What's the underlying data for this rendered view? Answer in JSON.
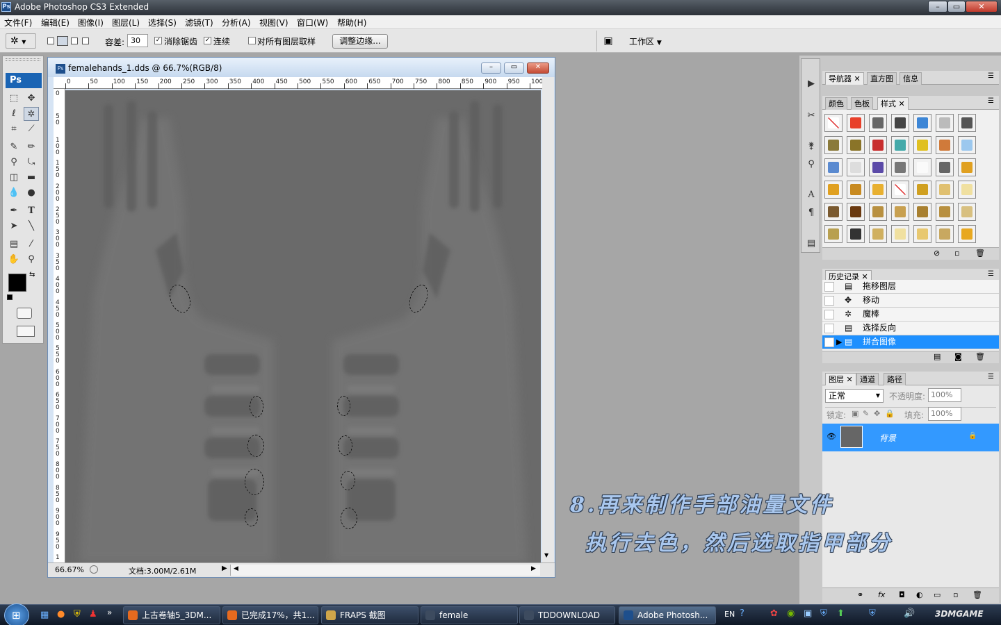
{
  "app": {
    "title": "Adobe Photoshop CS3 Extended",
    "badge": "Ps"
  },
  "menu": [
    "文件(F)",
    "编辑(E)",
    "图像(I)",
    "图层(L)",
    "选择(S)",
    "滤镜(T)",
    "分析(A)",
    "视图(V)",
    "窗口(W)",
    "帮助(H)"
  ],
  "options": {
    "tolerance_label": "容差:",
    "tolerance_value": "30",
    "antialias_label": "消除锯齿",
    "contiguous_label": "连续",
    "sample_all_label": "对所有图层取样",
    "refine_edge_label": "调整边缘...",
    "workspace_label": "工作区"
  },
  "document": {
    "title": "femalehands_1.dds @ 66.7%(RGB/8)",
    "zoom": "66.67%",
    "doc_info": "文档:3.00M/2.61M",
    "ruler_h": [
      "0",
      "50",
      "100",
      "150",
      "200",
      "250",
      "300",
      "350",
      "400",
      "450",
      "500",
      "550",
      "600",
      "650",
      "700",
      "750",
      "800",
      "850",
      "900",
      "950",
      "100"
    ],
    "ruler_v": [
      "0",
      "5\n0",
      "1\n0\n0",
      "1\n5\n0",
      "2\n0\n0",
      "2\n5\n0",
      "3\n0\n0",
      "3\n5\n0",
      "4\n0\n0",
      "4\n5\n0",
      "5\n0\n0",
      "5\n5\n0",
      "6\n0\n0",
      "6\n5\n0",
      "7\n0\n0",
      "7\n5\n0",
      "8\n0\n0",
      "8\n5\n0",
      "9\n0\n0",
      "9\n5\n0",
      "1"
    ]
  },
  "navigator_panel": {
    "tabs": [
      "导航器",
      "直方图",
      "信息"
    ]
  },
  "styles_panel": {
    "tabs": [
      "颜色",
      "色板",
      "样式"
    ]
  },
  "history_panel": {
    "tab": "历史记录",
    "items": [
      "拖移图层",
      "移动",
      "魔棒",
      "选择反向",
      "拼合图像"
    ],
    "active_index": 4
  },
  "layers_panel": {
    "tabs": [
      "图层",
      "通道",
      "路径"
    ],
    "blend_mode": "正常",
    "opacity_label": "不透明度:",
    "opacity_value": "100%",
    "lock_label": "锁定:",
    "fill_label": "填充:",
    "fill_value": "100%",
    "layer_name": "背景"
  },
  "annotation": {
    "line1": "8.再来制作手部油量文件",
    "line2": "执行去色，然后选取指甲部分"
  },
  "taskbar": {
    "tasks": [
      "上古卷轴5_3DM...",
      "已完成17%，共1...",
      "FRAPS 截图",
      "female",
      "TDDOWNLOAD",
      "Adobe Photosh..."
    ],
    "active_index": 5,
    "lang": "EN",
    "tray_brand": "3DMGAME"
  },
  "colors": {
    "accent": "#1e90ff",
    "selection": "#3399ff",
    "canvas": "#6d6d6d",
    "annotation": "#a9c7ee"
  }
}
